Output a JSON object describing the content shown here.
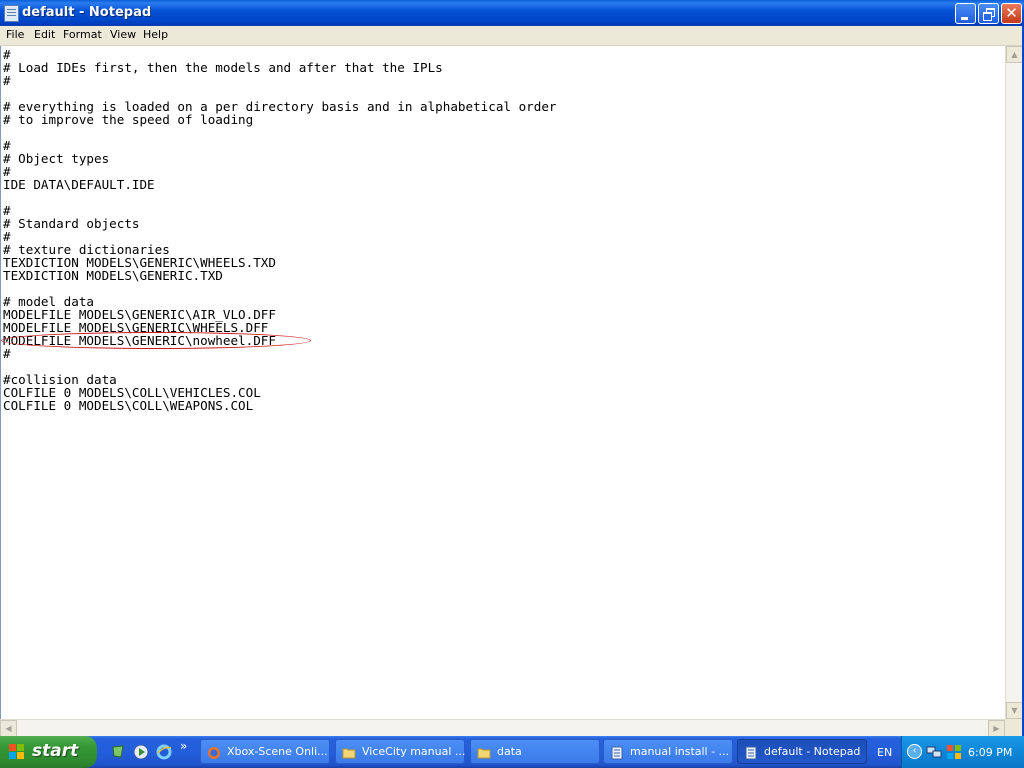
{
  "window": {
    "title": "default - Notepad"
  },
  "menu": {
    "file": "File",
    "edit": "Edit",
    "format": "Format",
    "view": "View",
    "help": "Help"
  },
  "editor": {
    "lines": [
      "#",
      "# Load IDEs first, then the models and after that the IPLs",
      "#",
      "",
      "# everything is loaded on a per directory basis and in alphabetical order",
      "# to improve the speed of loading",
      "",
      "#",
      "# Object types",
      "#",
      "IDE DATA\\DEFAULT.IDE",
      "",
      "#",
      "# Standard objects",
      "#",
      "# texture dictionaries",
      "TEXDICTION MODELS\\GENERIC\\WHEELS.TXD",
      "TEXDICTION MODELS\\GENERIC.TXD",
      "",
      "# model data",
      "MODELFILE MODELS\\GENERIC\\AIR_VLO.DFF",
      "MODELFILE MODELS\\GENERIC\\WHEELS.DFF",
      "MODELFILE MODELS\\GENERIC\\nowheel.DFF",
      "#",
      "",
      "#collision data",
      "COLFILE 0 MODELS\\COLL\\VEHICLES.COL",
      "COLFILE 0 MODELS\\COLL\\WEAPONS.COL"
    ]
  },
  "taskbar": {
    "start_label": "start",
    "tasks": [
      {
        "label": "Xbox-Scene Onli...",
        "icon": "firefox-icon"
      },
      {
        "label": "ViceCity manual ...",
        "icon": "folder-icon"
      },
      {
        "label": "data",
        "icon": "folder-icon"
      },
      {
        "label": "manual install - ...",
        "icon": "notepad-icon"
      },
      {
        "label": "default - Notepad",
        "icon": "notepad-icon",
        "active": true
      }
    ],
    "language": "EN",
    "clock": "6:09 PM"
  },
  "colors": {
    "title_bar": "#0054e3",
    "taskbar": "#245edb",
    "start_button": "#379a37",
    "annotation": "#cc1a1a"
  }
}
